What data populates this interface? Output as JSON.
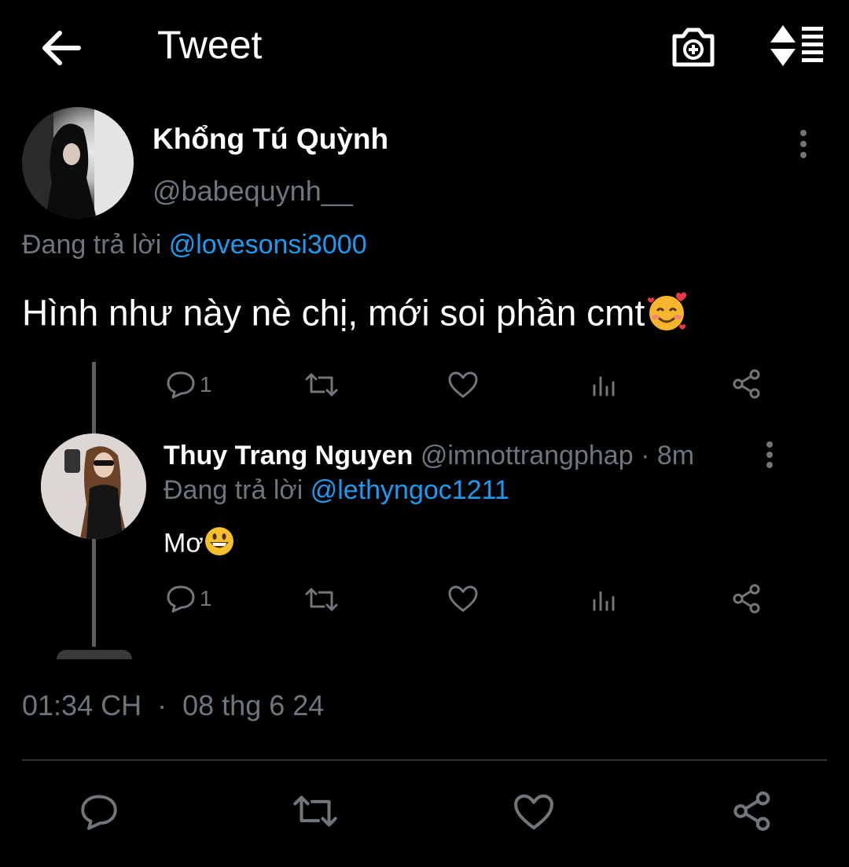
{
  "header": {
    "title": "Tweet"
  },
  "icons": {
    "back": "arrow-left-icon",
    "camera": "camera-plus-icon",
    "sort": "sort-icon",
    "more": "more-vertical-icon",
    "reply": "reply-icon",
    "retweet": "retweet-icon",
    "like": "heart-icon",
    "stats": "stats-icon",
    "share": "share-icon"
  },
  "main_tweet": {
    "author_name": "Khổng Tú Quỳnh",
    "author_handle": "@babequynh__",
    "replying_prefix": "Đang trả lời",
    "replying_to": "@lovesonsi3000",
    "text": "Hình như này nè chị, mới soi phần cmt",
    "emoji": "smiling-face-with-hearts",
    "reply_count": "1",
    "timestamp_time": "01:34 CH",
    "timestamp_sep": "·",
    "timestamp_date": "08 thg 6 24"
  },
  "quoted_reply": {
    "author_name": "Thuy Trang Nguyen",
    "author_handle": "@imnottrangphap",
    "time": "· 8m",
    "replying_prefix": "Đang trả lời",
    "replying_to": "@lethyngoc1211",
    "text": "Mơ",
    "emoji": "grinning-face",
    "reply_count": "1"
  },
  "colors": {
    "background": "#000000",
    "accent": "#1d9bf0",
    "secondary_text": "#6e767d"
  }
}
